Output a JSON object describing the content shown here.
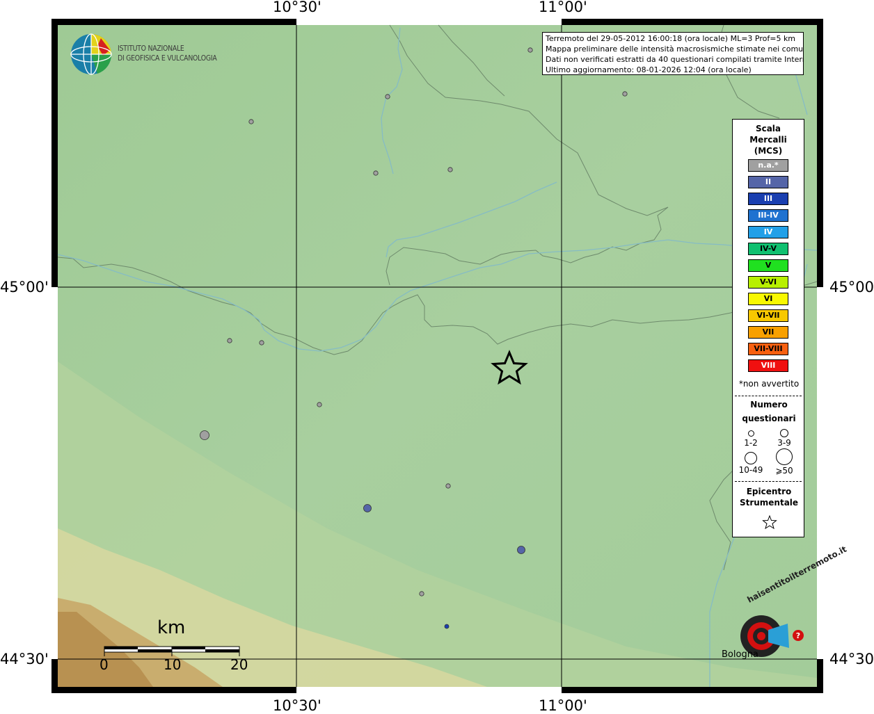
{
  "frame_labels": {
    "top_left_lon": "10°30'",
    "top_right_lon": "11°00'",
    "bottom_left_lon": "10°30'",
    "bottom_right_lon": "11°00'",
    "left_upper_lat": "45°00'",
    "left_lower_lat": "44°30'",
    "right_upper_lat": "45°00'",
    "right_lower_lat": "44°30'"
  },
  "logo": {
    "line1": "ISTITUTO NAZIONALE",
    "line2": "DI GEOFISICA E VULCANOLOGIA"
  },
  "info": {
    "line1": "Terremoto del 29-05-2012 16:00:18 (ora locale) ML=3 Prof=5 km",
    "line2": "Mappa preliminare delle intensità macrosismiche stimate nei comuni",
    "line3": "Dati non verificati estratti da 40 questionari compilati tramite Internet.",
    "line4": "Ultimo aggiornamento: 08-01-2026 12:04 (ora locale)"
  },
  "legend": {
    "title1": "Scala",
    "title2": "Mercalli",
    "title3": "(MCS)",
    "scale": [
      {
        "label": "n.a.*",
        "color": "#a0a0a0",
        "text_color": "#ffffff"
      },
      {
        "label": "II",
        "color": "#5565a8",
        "text_color": "#ffffff"
      },
      {
        "label": "III",
        "color": "#1a3fb0",
        "text_color": "#ffffff"
      },
      {
        "label": "III-IV",
        "color": "#1f72d0",
        "text_color": "#ffffff"
      },
      {
        "label": "IV",
        "color": "#22a0e8",
        "text_color": "#ffffff"
      },
      {
        "label": "IV-V",
        "color": "#10c070",
        "text_color": "#000000"
      },
      {
        "label": "V",
        "color": "#20e020",
        "text_color": "#000000"
      },
      {
        "label": "V-VI",
        "color": "#b8f000",
        "text_color": "#000000"
      },
      {
        "label": "VI",
        "color": "#f8f800",
        "text_color": "#000000"
      },
      {
        "label": "VI-VII",
        "color": "#f8c800",
        "text_color": "#000000"
      },
      {
        "label": "VII",
        "color": "#f8a000",
        "text_color": "#000000"
      },
      {
        "label": "VII-VIII",
        "color": "#f86010",
        "text_color": "#000000"
      },
      {
        "label": "VIII",
        "color": "#f01010",
        "text_color": "#ffffff"
      }
    ],
    "note": "*non avvertito",
    "count_title1": "Numero",
    "count_title2": "questionari",
    "count_1": "1-2",
    "count_2": "3-9",
    "count_3": "10-49",
    "count_4": "⩾50",
    "epi_title1": "Epicentro",
    "epi_title2": "Strumentale"
  },
  "scale_bar": {
    "unit": "km",
    "tick0": "0",
    "tick1": "10",
    "tick2": "20"
  },
  "hai_logo": {
    "text": "haisentitoilterremoto.it",
    "place": "Bologna"
  },
  "map_colors": {
    "plain": "#a6cc9c",
    "hills": "#e6d8a2",
    "mountains": "#c09a5a",
    "grid": "#000000",
    "river": "#8fc0c0",
    "boundary": "#6a8468"
  },
  "points": [
    {
      "intensity": "n.a.",
      "count": "1-2",
      "color": "#a0a0a0"
    },
    {
      "intensity": "n.a.",
      "count": "1-2",
      "color": "#a0a0a0"
    },
    {
      "intensity": "n.a.",
      "count": "1-2",
      "color": "#a0a0a0"
    },
    {
      "intensity": "n.a.",
      "count": "1-2",
      "color": "#a0a0a0"
    },
    {
      "intensity": "n.a.",
      "count": "1-2",
      "color": "#a0a0a0"
    },
    {
      "intensity": "n.a.",
      "count": "1-2",
      "color": "#a0a0a0"
    },
    {
      "intensity": "n.a.",
      "count": "1-2",
      "color": "#a0a0a0"
    },
    {
      "intensity": "n.a.",
      "count": "1-2",
      "color": "#a0a0a0"
    },
    {
      "intensity": "n.a.",
      "count": "1-2",
      "color": "#a0a0a0"
    },
    {
      "intensity": "n.a.",
      "count": "3-9",
      "color": "#a0a0a0"
    },
    {
      "intensity": "n.a.",
      "count": "1-2",
      "color": "#a0a0a0"
    },
    {
      "intensity": "n.a.",
      "count": "1-2",
      "color": "#a0a0a0"
    },
    {
      "intensity": "II",
      "count": "3-9",
      "color": "#5565a8"
    },
    {
      "intensity": "II",
      "count": "3-9",
      "color": "#5565a8"
    },
    {
      "intensity": "III",
      "count": "1-2",
      "color": "#1a3fb0"
    }
  ]
}
